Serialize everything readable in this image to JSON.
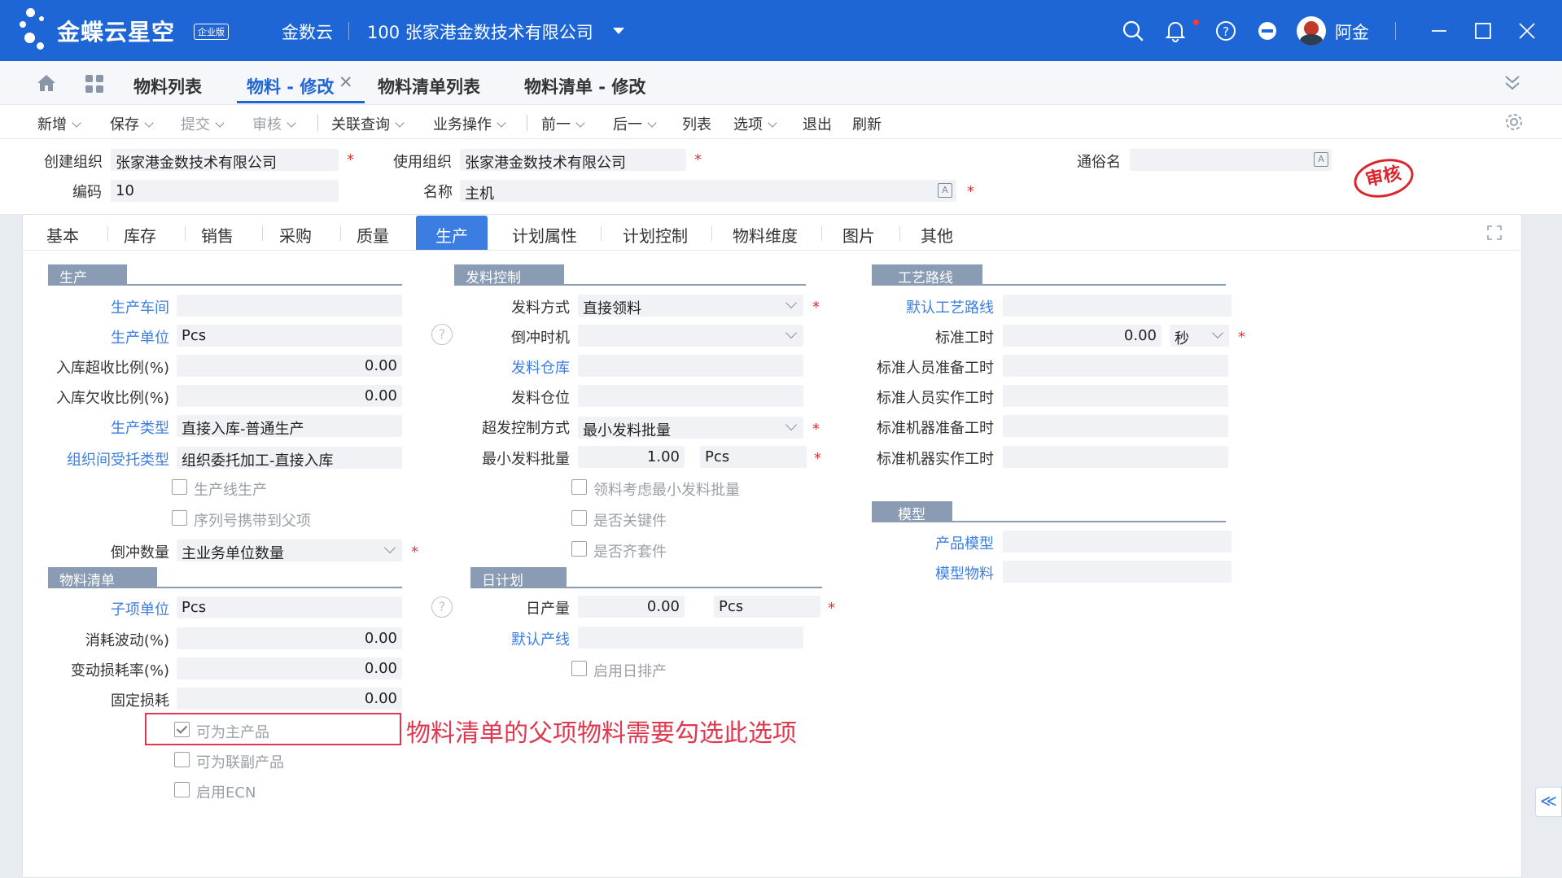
{
  "topbar": {
    "brand": "金蝶云星空",
    "edition_badge": "企业版",
    "product": "金数云",
    "org": "100  张家港金数技术有限公司",
    "user": "阿金"
  },
  "tabs": {
    "items": [
      {
        "label": "物料列表"
      },
      {
        "label": "物料 - 修改"
      },
      {
        "label": "物料清单列表"
      },
      {
        "label": "物料清单 - 修改"
      }
    ],
    "close_glyph": "✕"
  },
  "toolbar": {
    "new": "新增",
    "save": "保存",
    "submit": "提交",
    "audit": "审核",
    "related_query": "关联查询",
    "business_ops": "业务操作",
    "prev": "前一",
    "next": "后一",
    "list": "列表",
    "options": "选项",
    "exit": "退出",
    "refresh": "刷新"
  },
  "header": {
    "create_org_label": "创建组织",
    "create_org_value": "张家港金数技术有限公司",
    "use_org_label": "使用组织",
    "use_org_value": "张家港金数技术有限公司",
    "common_name_label": "通俗名",
    "common_name_value": "",
    "code_label": "编码",
    "code_value": "10",
    "name_label": "名称",
    "name_value": "主机",
    "stamp": "审核"
  },
  "subtabs": [
    "基本",
    "库存",
    "销售",
    "采购",
    "质量",
    "生产",
    "计划属性",
    "计划控制",
    "物料维度",
    "图片",
    "其他"
  ],
  "production": {
    "title": "生产",
    "workshop_label": "生产车间",
    "workshop_value": "",
    "unit_label": "生产单位",
    "unit_value": "Pcs",
    "over_ratio_label": "入库超收比例(%)",
    "over_ratio_value": "0.00",
    "under_ratio_label": "入库欠收比例(%)",
    "under_ratio_value": "0.00",
    "type_label": "生产类型",
    "type_value": "直接入库-普通生产",
    "consign_type_label": "组织间受托类型",
    "consign_type_value": "组织委托加工-直接入库",
    "line_production": "生产线生产",
    "serial_carry": "序列号携带到父项",
    "backflush_qty_label": "倒冲数量",
    "backflush_qty_value": "主业务单位数量"
  },
  "issue_control": {
    "title": "发料控制",
    "issue_method_label": "发料方式",
    "issue_method_value": "直接领料",
    "backflush_time_label": "倒冲时机",
    "backflush_time_value": "",
    "issue_wh_label": "发料仓库",
    "issue_wh_value": "",
    "issue_loc_label": "发料仓位",
    "issue_loc_value": "",
    "over_issue_label": "超发控制方式",
    "over_issue_value": "最小发料批量",
    "min_batch_label": "最小发料批量",
    "min_batch_value": "1.00",
    "min_batch_unit": "Pcs",
    "consider_min_batch": "领料考虑最小发料批量",
    "key_part": "是否关键件",
    "kit_part": "是否齐套件"
  },
  "routing": {
    "title": "工艺路线",
    "default_route_label": "默认工艺路线",
    "default_route_value": "",
    "std_hours_label": "标准工时",
    "std_hours_value": "0.00",
    "std_hours_unit": "秒",
    "std_labor_prep_label": "标准人员准备工时",
    "std_labor_actual_label": "标准人员实作工时",
    "std_machine_prep_label": "标准机器准备工时",
    "std_machine_actual_label": "标准机器实作工时"
  },
  "model": {
    "title": "模型",
    "product_model_label": "产品模型",
    "model_material_label": "模型物料"
  },
  "bom": {
    "title": "物料清单",
    "child_unit_label": "子项单位",
    "child_unit_value": "Pcs",
    "consumption_label": "消耗波动(%)",
    "consumption_value": "0.00",
    "variable_loss_label": "变动损耗率(%)",
    "variable_loss_value": "0.00",
    "fixed_loss_label": "固定损耗",
    "fixed_loss_value": "0.00",
    "main_product": "可为主产品",
    "main_product_checked": true,
    "co_product": "可为联副产品",
    "enable_ecn": "启用ECN"
  },
  "daily_plan": {
    "title": "日计划",
    "daily_output_label": "日产量",
    "daily_output_value": "0.00",
    "daily_output_unit": "Pcs",
    "default_line_label": "默认产线",
    "default_line_value": "",
    "enable_daily": "启用日排产"
  },
  "annotation": {
    "note": "物料清单的父项物料需要勾选此选项"
  },
  "icons": {
    "search": "search-icon",
    "bell": "bell-icon",
    "help": "help-icon",
    "apps": "apps-icon",
    "home": "home-icon",
    "settings": "gear-icon",
    "lang": "A",
    "help_glyph": "?",
    "side_glyph": "≪"
  },
  "colors": {
    "brand": "#1e66d6",
    "link": "#3b7de0",
    "required": "#e8302f",
    "note": "#e0384f"
  }
}
